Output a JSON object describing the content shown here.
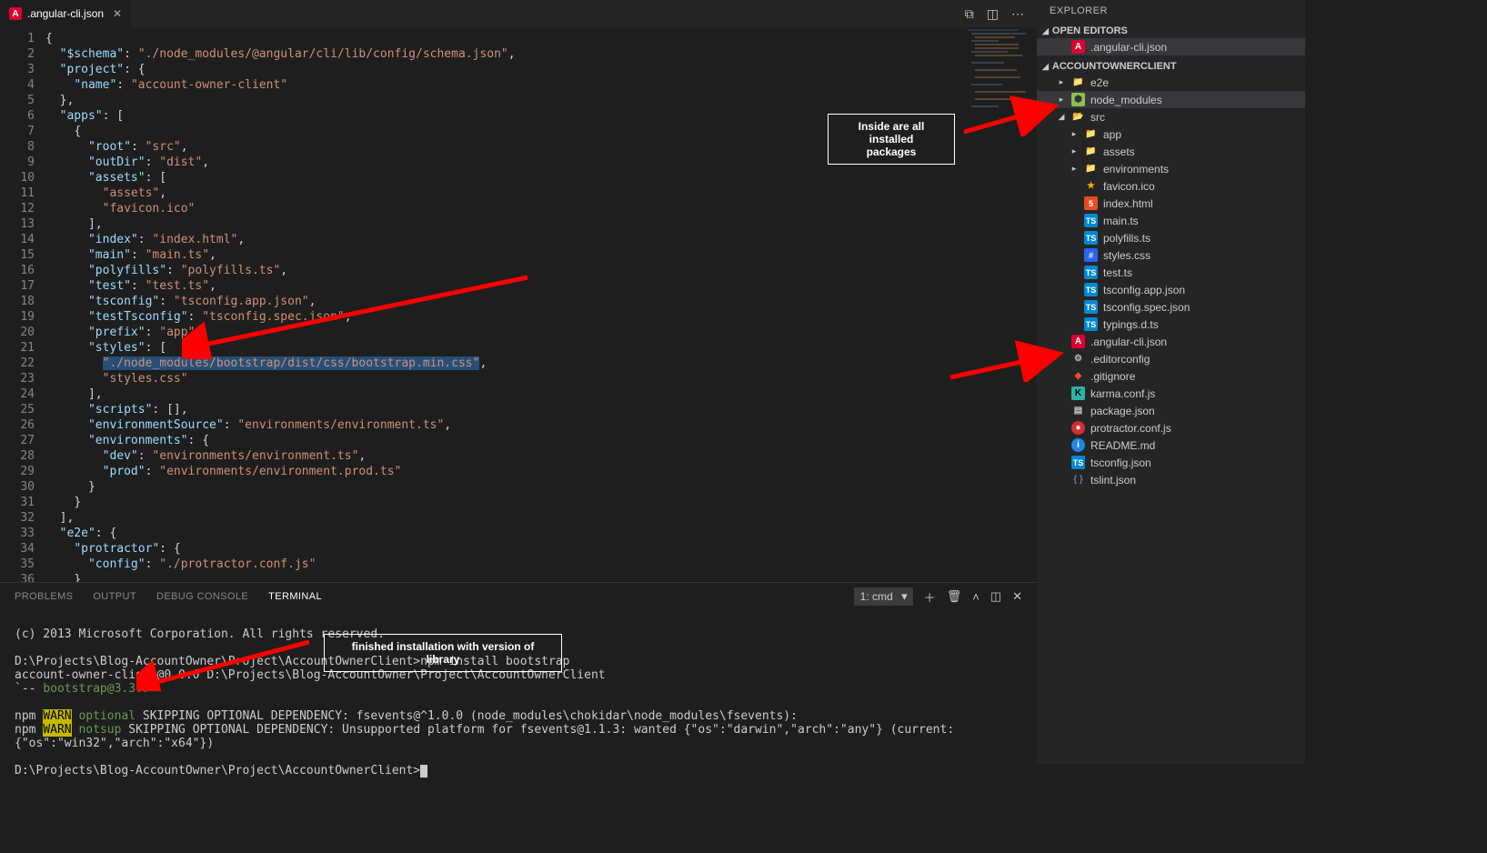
{
  "tab": {
    "filename": ".angular-cli.json"
  },
  "sidebar": {
    "title": "EXPLORER",
    "openEditors": {
      "label": "OPEN EDITORS",
      "items": [
        ".angular-cli.json"
      ]
    },
    "project": {
      "label": "ACCOUNTOWNERCLIENT",
      "tree": [
        {
          "t": "folder",
          "lbl": "e2e",
          "d": 1
        },
        {
          "t": "npmfolder",
          "lbl": "node_modules",
          "d": 1,
          "hover": true
        },
        {
          "t": "folderg",
          "lbl": "src",
          "d": 1,
          "open": true
        },
        {
          "t": "folder",
          "lbl": "app",
          "d": 2
        },
        {
          "t": "folder",
          "lbl": "assets",
          "d": 2
        },
        {
          "t": "folder",
          "lbl": "environments",
          "d": 2
        },
        {
          "t": "star",
          "lbl": "favicon.ico",
          "d": 2
        },
        {
          "t": "html",
          "lbl": "index.html",
          "d": 2
        },
        {
          "t": "ts",
          "lbl": "main.ts",
          "d": 2
        },
        {
          "t": "ts",
          "lbl": "polyfills.ts",
          "d": 2
        },
        {
          "t": "css",
          "lbl": "styles.css",
          "d": 2
        },
        {
          "t": "ts",
          "lbl": "test.ts",
          "d": 2
        },
        {
          "t": "ts",
          "lbl": "tsconfig.app.json",
          "d": 2
        },
        {
          "t": "ts",
          "lbl": "tsconfig.spec.json",
          "d": 2
        },
        {
          "t": "ts",
          "lbl": "typings.d.ts",
          "d": 2
        },
        {
          "t": "ang",
          "lbl": ".angular-cli.json",
          "d": 1,
          "dim": false
        },
        {
          "t": "gear",
          "lbl": ".editorconfig",
          "d": 1
        },
        {
          "t": "git",
          "lbl": ".gitignore",
          "d": 1
        },
        {
          "t": "k",
          "lbl": "karma.conf.js",
          "d": 1
        },
        {
          "t": "json",
          "lbl": "package.json",
          "d": 1
        },
        {
          "t": "p",
          "lbl": "protractor.conf.js",
          "d": 1
        },
        {
          "t": "info",
          "lbl": "README.md",
          "d": 1
        },
        {
          "t": "ts",
          "lbl": "tsconfig.json",
          "d": 1
        },
        {
          "t": "bkt",
          "lbl": "tslint.json",
          "d": 1
        }
      ]
    }
  },
  "code": [
    [
      [
        "brace",
        "{"
      ]
    ],
    [
      [
        "sp",
        "  "
      ],
      [
        "key",
        "\"$schema\""
      ],
      [
        "punc",
        ": "
      ],
      [
        "str",
        "\"./node_modules/@angular/cli/lib/config/schema.json\""
      ],
      [
        "punc",
        ","
      ]
    ],
    [
      [
        "sp",
        "  "
      ],
      [
        "key",
        "\"project\""
      ],
      [
        "punc",
        ": {"
      ]
    ],
    [
      [
        "sp",
        "    "
      ],
      [
        "key",
        "\"name\""
      ],
      [
        "punc",
        ": "
      ],
      [
        "str",
        "\"account-owner-client\""
      ]
    ],
    [
      [
        "sp",
        "  "
      ],
      [
        "punc",
        "},"
      ]
    ],
    [
      [
        "sp",
        "  "
      ],
      [
        "key",
        "\"apps\""
      ],
      [
        "punc",
        ": ["
      ]
    ],
    [
      [
        "sp",
        "    "
      ],
      [
        "punc",
        "{"
      ]
    ],
    [
      [
        "sp",
        "      "
      ],
      [
        "key",
        "\"root\""
      ],
      [
        "punc",
        ": "
      ],
      [
        "str",
        "\"src\""
      ],
      [
        "punc",
        ","
      ]
    ],
    [
      [
        "sp",
        "      "
      ],
      [
        "key",
        "\"outDir\""
      ],
      [
        "punc",
        ": "
      ],
      [
        "str",
        "\"dist\""
      ],
      [
        "punc",
        ","
      ]
    ],
    [
      [
        "sp",
        "      "
      ],
      [
        "key",
        "\"assets\""
      ],
      [
        "punc",
        ": ["
      ]
    ],
    [
      [
        "sp",
        "        "
      ],
      [
        "str",
        "\"assets\""
      ],
      [
        "punc",
        ","
      ]
    ],
    [
      [
        "sp",
        "        "
      ],
      [
        "str",
        "\"favicon.ico\""
      ]
    ],
    [
      [
        "sp",
        "      "
      ],
      [
        "punc",
        "],"
      ]
    ],
    [
      [
        "sp",
        "      "
      ],
      [
        "key",
        "\"index\""
      ],
      [
        "punc",
        ": "
      ],
      [
        "str",
        "\"index.html\""
      ],
      [
        "punc",
        ","
      ]
    ],
    [
      [
        "sp",
        "      "
      ],
      [
        "key",
        "\"main\""
      ],
      [
        "punc",
        ": "
      ],
      [
        "str",
        "\"main.ts\""
      ],
      [
        "punc",
        ","
      ]
    ],
    [
      [
        "sp",
        "      "
      ],
      [
        "key",
        "\"polyfills\""
      ],
      [
        "punc",
        ": "
      ],
      [
        "str",
        "\"polyfills.ts\""
      ],
      [
        "punc",
        ","
      ]
    ],
    [
      [
        "sp",
        "      "
      ],
      [
        "key",
        "\"test\""
      ],
      [
        "punc",
        ": "
      ],
      [
        "str",
        "\"test.ts\""
      ],
      [
        "punc",
        ","
      ]
    ],
    [
      [
        "sp",
        "      "
      ],
      [
        "key",
        "\"tsconfig\""
      ],
      [
        "punc",
        ": "
      ],
      [
        "str",
        "\"tsconfig.app.json\""
      ],
      [
        "punc",
        ","
      ]
    ],
    [
      [
        "sp",
        "      "
      ],
      [
        "key",
        "\"testTsconfig\""
      ],
      [
        "punc",
        ": "
      ],
      [
        "str",
        "\"tsconfig.spec.json\""
      ],
      [
        "punc",
        ","
      ]
    ],
    [
      [
        "sp",
        "      "
      ],
      [
        "key",
        "\"prefix\""
      ],
      [
        "punc",
        ": "
      ],
      [
        "str",
        "\"app\""
      ],
      [
        "punc",
        ","
      ]
    ],
    [
      [
        "sp",
        "      "
      ],
      [
        "key",
        "\"styles\""
      ],
      [
        "punc",
        ": ["
      ]
    ],
    [
      [
        "sp",
        "        "
      ],
      [
        "hlstr",
        "\"./node_modules/bootstrap/dist/css/bootstrap.min.css\""
      ],
      [
        "punc",
        ","
      ]
    ],
    [
      [
        "sp",
        "        "
      ],
      [
        "str",
        "\"styles.css\""
      ]
    ],
    [
      [
        "sp",
        "      "
      ],
      [
        "punc",
        "],"
      ]
    ],
    [
      [
        "sp",
        "      "
      ],
      [
        "key",
        "\"scripts\""
      ],
      [
        "punc",
        ": [],"
      ]
    ],
    [
      [
        "sp",
        "      "
      ],
      [
        "key",
        "\"environmentSource\""
      ],
      [
        "punc",
        ": "
      ],
      [
        "str",
        "\"environments/environment.ts\""
      ],
      [
        "punc",
        ","
      ]
    ],
    [
      [
        "sp",
        "      "
      ],
      [
        "key",
        "\"environments\""
      ],
      [
        "punc",
        ": {"
      ]
    ],
    [
      [
        "sp",
        "        "
      ],
      [
        "key",
        "\"dev\""
      ],
      [
        "punc",
        ": "
      ],
      [
        "str",
        "\"environments/environment.ts\""
      ],
      [
        "punc",
        ","
      ]
    ],
    [
      [
        "sp",
        "        "
      ],
      [
        "key",
        "\"prod\""
      ],
      [
        "punc",
        ": "
      ],
      [
        "str",
        "\"environments/environment.prod.ts\""
      ]
    ],
    [
      [
        "sp",
        "      "
      ],
      [
        "punc",
        "}"
      ]
    ],
    [
      [
        "sp",
        "    "
      ],
      [
        "punc",
        "}"
      ]
    ],
    [
      [
        "sp",
        "  "
      ],
      [
        "punc",
        "],"
      ]
    ],
    [
      [
        "sp",
        "  "
      ],
      [
        "key",
        "\"e2e\""
      ],
      [
        "punc",
        ": {"
      ]
    ],
    [
      [
        "sp",
        "    "
      ],
      [
        "key",
        "\"protractor\""
      ],
      [
        "punc",
        ": {"
      ]
    ],
    [
      [
        "sp",
        "      "
      ],
      [
        "key",
        "\"config\""
      ],
      [
        "punc",
        ": "
      ],
      [
        "str",
        "\"./protractor.conf.js\""
      ]
    ],
    [
      [
        "sp",
        "    "
      ],
      [
        "punc",
        "}"
      ]
    ]
  ],
  "panel": {
    "tabs": [
      "PROBLEMS",
      "OUTPUT",
      "DEBUG CONSOLE",
      "TERMINAL"
    ],
    "active": "TERMINAL",
    "select": "1: cmd"
  },
  "terminal": {
    "copyright": "(c) 2013 Microsoft Corporation. All rights reserved.",
    "l1a": "D:\\Projects\\Blog-AccountOwner\\Project\\AccountOwnerClient>",
    "l1b": "npm install bootstrap",
    "l2": "account-owner-client@0.0.0 D:\\Projects\\Blog-AccountOwner\\Project\\AccountOwnerClient",
    "l3a": "`-- ",
    "l3b": "bootstrap@3.3.7",
    "w1a": "npm ",
    "w1warn": "WARN",
    "w1b": " optional",
    "w1c": " SKIPPING OPTIONAL DEPENDENCY: fsevents@^1.0.0 (node_modules\\chokidar\\node_modules\\fsevents):",
    "w2a": "npm ",
    "w2warn": "WARN",
    "w2b": " notsup",
    "w2c": " SKIPPING OPTIONAL DEPENDENCY: Unsupported platform for fsevents@1.1.3: wanted {\"os\":\"darwin\",\"arch\":\"any\"} (current: {\"os\":\"win32\",\"arch\":\"x64\"})",
    "prompt": "D:\\Projects\\Blog-AccountOwner\\Project\\AccountOwnerClient>"
  },
  "annotations": {
    "box1": "Inside are all installed\npackages",
    "box2": "finished installation with version of library"
  }
}
